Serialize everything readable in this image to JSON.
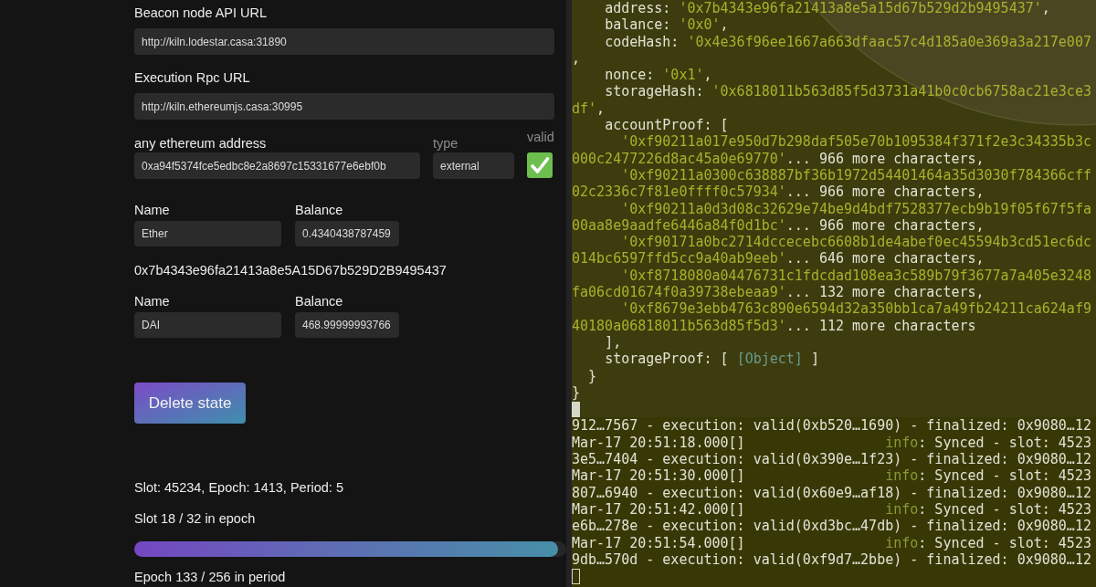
{
  "browser_page": {
    "url_fields": [
      {
        "label": "Beacon node API URL",
        "value": "http://kiln.lodestar.casa:31890"
      },
      {
        "label": "Execution Rpc URL",
        "value": "http://kiln.ethereumjs.casa:30995"
      }
    ],
    "address_check": {
      "address_label": "any ethereum address",
      "address": "0xa94f5374fce5edbc8e2a8697c15331677e6ebf0b",
      "type_label": "type",
      "type": "external",
      "valid_label": "valid",
      "valid": true
    },
    "assets": [
      {
        "kind": "balance",
        "name_label": "Name",
        "balance_label": "Balance",
        "name": "Ether",
        "balance": "0.4340438787459"
      },
      {
        "kind": "address",
        "text": "0x7b4343e96fa21413a8e5A15D67b529D2B9495437"
      },
      {
        "kind": "balance",
        "name_label": "Name",
        "balance_label": "Balance",
        "name": "DAI",
        "balance": "468.99999993766"
      }
    ],
    "delete_button": "Delete state",
    "sync_status": {
      "summary": "Slot: 45234, Epoch: 1413, Period: 5",
      "epoch_progress": "Slot 18 / 32 in epoch",
      "level": 0.98,
      "period_progress": "Epoch 133 / 256 in period"
    }
  },
  "terminal_overlay": {
    "cursor_focused": true,
    "lines": [
      [
        {
          "kind": "plain",
          "text": "    address: "
        },
        {
          "kind": "string",
          "text": "'0x7b4343e96fa21413a8e5a15d67b529d2b9495437'"
        },
        {
          "kind": "plain",
          "text": ","
        }
      ],
      [
        {
          "kind": "plain",
          "text": "    balance: "
        },
        {
          "kind": "string",
          "text": "'0x0'"
        },
        {
          "kind": "plain",
          "text": ","
        }
      ],
      [
        {
          "kind": "plain",
          "text": "    codeHash: "
        },
        {
          "kind": "string",
          "text": "'0x4e36f96ee1667a663dfaac57c4d185a0e369a3a217e007"
        }
      ],
      [
        {
          "kind": "plain",
          "text": ","
        }
      ],
      [
        {
          "kind": "plain",
          "text": "    nonce: "
        },
        {
          "kind": "string",
          "text": "'0x1'"
        },
        {
          "kind": "plain",
          "text": ","
        }
      ],
      [
        {
          "kind": "plain",
          "text": "    storageHash: "
        },
        {
          "kind": "string",
          "text": "'0x6818011b563d85f5d3731a41b0c0cb6758ac21e3ce3"
        }
      ],
      [
        {
          "kind": "string",
          "text": "df'"
        },
        {
          "kind": "plain",
          "text": ","
        }
      ],
      [
        {
          "kind": "plain",
          "text": "    accountProof: ["
        }
      ],
      [
        {
          "kind": "string",
          "text": "      '0xf90211a017e950d7b298daf505e70b1095384f371f2e3c34335b3c"
        }
      ],
      [
        {
          "kind": "string",
          "text": "000c2477226d8ac45a0e69770'"
        },
        {
          "kind": "plain",
          "text": "... 966 more characters,"
        }
      ],
      [
        {
          "kind": "string",
          "text": "      '0xf90211a0300c638887bf36b1972d54401464a35d3030f784366cff"
        }
      ],
      [
        {
          "kind": "string",
          "text": "02c2336c7f81e0ffff0c57934'"
        },
        {
          "kind": "plain",
          "text": "... 966 more characters,"
        }
      ],
      [
        {
          "kind": "string",
          "text": "      '0xf90211a0d3d08c32629e74be9d4bdf7528377ecb9b19f05f67f5fa"
        }
      ],
      [
        {
          "kind": "string",
          "text": "00aa8e9aadfe6446a84f0d1bc'"
        },
        {
          "kind": "plain",
          "text": "... 966 more characters,"
        }
      ],
      [
        {
          "kind": "string",
          "text": "      '0xf90171a0bc2714dccecebc6608b1de4abef0ec45594b3cd51ec6dc"
        }
      ],
      [
        {
          "kind": "string",
          "text": "014bc6597ffd5cc9a40ab9eeb'"
        },
        {
          "kind": "plain",
          "text": "... 646 more characters,"
        }
      ],
      [
        {
          "kind": "string",
          "text": "      '0xf8718080a04476731c1fdcdad108ea3c589b79f3677a7a405e3248"
        }
      ],
      [
        {
          "kind": "string",
          "text": "fa06cd01674f0a39738ebeaa9'"
        },
        {
          "kind": "plain",
          "text": "... 132 more characters,"
        }
      ],
      [
        {
          "kind": "string",
          "text": "      '0xf8679e3ebb4763c890e6594d32a350bb1ca7a49fb24211ca624af9"
        }
      ],
      [
        {
          "kind": "string",
          "text": "40180a06818011b563d85f5d3'"
        },
        {
          "kind": "plain",
          "text": "... 112 more characters"
        }
      ],
      [
        {
          "kind": "plain",
          "text": "    ],"
        }
      ],
      [
        {
          "kind": "plain",
          "text": "    storageProof: [ "
        },
        {
          "kind": "object",
          "text": "[Object]"
        },
        {
          "kind": "plain",
          "text": " ]"
        }
      ],
      [
        {
          "kind": "plain",
          "text": "  }"
        }
      ],
      [
        {
          "kind": "plain",
          "text": "}"
        }
      ]
    ]
  },
  "terminal_log": {
    "cursor_focused": false,
    "lines": [
      [
        {
          "kind": "plain",
          "text": "912…7567 - execution: valid(0xb520…1690) - finalized: 0x9080…12"
        }
      ],
      [
        {
          "kind": "plain",
          "text": "Mar-17 20:51:18.000[]                 "
        },
        {
          "kind": "level",
          "text": "info"
        },
        {
          "kind": "plain",
          "text": ": Synced - slot: 4523"
        }
      ],
      [
        {
          "kind": "plain",
          "text": "3e5…7404 - execution: valid(0x390e…1f23) - finalized: 0x9080…12"
        }
      ],
      [
        {
          "kind": "plain",
          "text": "Mar-17 20:51:30.000[]                 "
        },
        {
          "kind": "level",
          "text": "info"
        },
        {
          "kind": "plain",
          "text": ": Synced - slot: 4523"
        }
      ],
      [
        {
          "kind": "plain",
          "text": "807…6940 - execution: valid(0x60e9…af18) - finalized: 0x9080…12"
        }
      ],
      [
        {
          "kind": "plain",
          "text": "Mar-17 20:51:42.000[]                 "
        },
        {
          "kind": "level",
          "text": "info"
        },
        {
          "kind": "plain",
          "text": ": Synced - slot: 4523"
        }
      ],
      [
        {
          "kind": "plain",
          "text": "e6b…278e - execution: valid(0xd3bc…47db) - finalized: 0x9080…12"
        }
      ],
      [
        {
          "kind": "plain",
          "text": "Mar-17 20:51:54.000[]                 "
        },
        {
          "kind": "level",
          "text": "info"
        },
        {
          "kind": "plain",
          "text": ": Synced - slot: 4523"
        }
      ],
      [
        {
          "kind": "plain",
          "text": "9db…570d - execution: valid(0xf9d7…2bbe) - finalized: 0x9080…12"
        }
      ]
    ]
  }
}
